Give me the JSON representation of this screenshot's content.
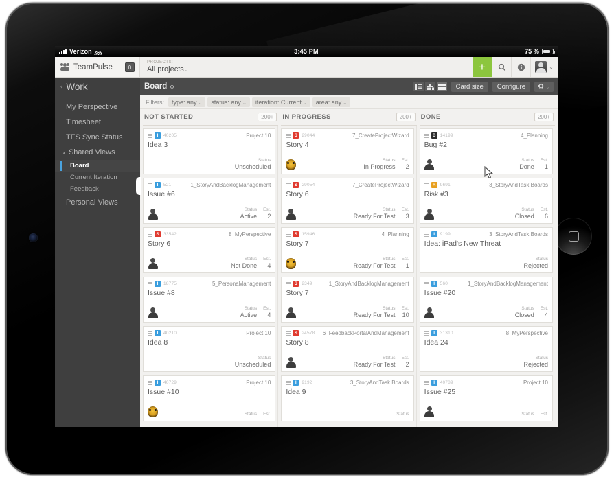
{
  "status_bar": {
    "carrier": "Verizon",
    "time": "3:45 PM",
    "battery": "75 %"
  },
  "app_bar": {
    "brand": "TeamPulse",
    "brand_badge": "0",
    "projects_label": "PROJECTS:",
    "projects_value": "All projects",
    "caret": "⌄",
    "add_icon": "+",
    "search_icon": "search-icon",
    "info_icon": "info-icon",
    "user_caret": "⌄"
  },
  "nav_bar": {
    "back_chevron": "‹",
    "section_title": "Work",
    "board_label": "Board",
    "card_size_label": "Card size",
    "configure_label": "Configure",
    "gear_icon": "⚙",
    "gear_caret": "⌄"
  },
  "sidebar": {
    "items": [
      {
        "label": "My Perspective",
        "type": "item"
      },
      {
        "label": "Timesheet",
        "type": "item"
      },
      {
        "label": "TFS Sync Status",
        "type": "item"
      },
      {
        "label": "Shared Views",
        "type": "group"
      },
      {
        "label": "Board",
        "type": "sub",
        "active": true
      },
      {
        "label": "Current Iteration",
        "type": "sub"
      },
      {
        "label": "Feedback",
        "type": "sub"
      },
      {
        "label": "Personal Views",
        "type": "item"
      }
    ]
  },
  "filters": {
    "label": "Filters:",
    "chips": [
      {
        "text": "type: any"
      },
      {
        "text": "status: any"
      },
      {
        "text": "iteration: Current"
      },
      {
        "text": "area: any"
      }
    ]
  },
  "columns": [
    {
      "title": "NOT STARTED",
      "count": "200+",
      "cards": [
        {
          "type": "idea",
          "badge": "I",
          "id": "40205",
          "project": "Project 10",
          "title": "Idea 3",
          "avatar": "none",
          "status_key": "Status",
          "status": "Unscheduled",
          "est_key": "",
          "est": ""
        },
        {
          "type": "issue",
          "badge": "I",
          "id": "521",
          "project": "1_StoryAndBacklogManagement",
          "title": "Issue #6",
          "avatar": "person",
          "status_key": "Status",
          "status": "Active",
          "est_key": "Est.",
          "est": "2"
        },
        {
          "type": "story",
          "badge": "S",
          "id": "33542",
          "project": "8_MyPerspective",
          "title": "Story 6",
          "avatar": "person",
          "status_key": "Status",
          "status": "Not Done",
          "est_key": "Est.",
          "est": "4"
        },
        {
          "type": "issue",
          "badge": "I",
          "id": "18775",
          "project": "5_PersonaManagement",
          "title": "Issue #8",
          "avatar": "person",
          "status_key": "Status",
          "status": "Active",
          "est_key": "Est.",
          "est": "4"
        },
        {
          "type": "idea",
          "badge": "I",
          "id": "40210",
          "project": "Project 10",
          "title": "Idea 8",
          "avatar": "none",
          "status_key": "Status",
          "status": "Unscheduled",
          "est_key": "",
          "est": ""
        },
        {
          "type": "issue",
          "badge": "I",
          "id": "40729",
          "project": "Project 10",
          "title": "Issue #10",
          "avatar": "cat",
          "status_key": "Status",
          "status": "",
          "est_key": "Est.",
          "est": ""
        }
      ]
    },
    {
      "title": "IN PROGRESS",
      "count": "200+",
      "cards": [
        {
          "type": "story",
          "badge": "S",
          "id": "29044",
          "project": "7_CreateProjectWizard",
          "title": "Story 4",
          "avatar": "cat",
          "status_key": "Status",
          "status": "In Progress",
          "est_key": "Est.",
          "est": "2"
        },
        {
          "type": "story",
          "badge": "S",
          "id": "29054",
          "project": "7_CreateProjectWizard",
          "title": "Story 6",
          "avatar": "person",
          "status_key": "Status",
          "status": "Ready For Test",
          "est_key": "Est.",
          "est": "3"
        },
        {
          "type": "story",
          "badge": "S",
          "id": "15946",
          "project": "4_Planning",
          "title": "Story 7",
          "avatar": "cat",
          "status_key": "Status",
          "status": "Ready For Test",
          "est_key": "Est.",
          "est": "1"
        },
        {
          "type": "story",
          "badge": "S",
          "id": "2349",
          "project": "1_StoryAndBacklogManagement",
          "title": "Story 7",
          "avatar": "person",
          "status_key": "Status",
          "status": "Ready For Test",
          "est_key": "Est.",
          "est": "10"
        },
        {
          "type": "story",
          "badge": "S",
          "id": "24578",
          "project": "6_FeedbackPortalAndManagement",
          "title": "Story 8",
          "avatar": "person",
          "status_key": "Status",
          "status": "Ready For Test",
          "est_key": "Est.",
          "est": "2"
        },
        {
          "type": "idea",
          "badge": "I",
          "id": "9192",
          "project": "3_StoryAndTask Boards",
          "title": "Idea 9",
          "avatar": "none",
          "status_key": "Status",
          "status": "",
          "est_key": "",
          "est": ""
        }
      ]
    },
    {
      "title": "DONE",
      "count": "200+",
      "cards": [
        {
          "type": "bug",
          "badge": "B",
          "id": "14199",
          "project": "4_Planning",
          "title": "Bug #2",
          "avatar": "person",
          "status_key": "Status",
          "status": "Done",
          "est_key": "Est.",
          "est": "1"
        },
        {
          "type": "risk",
          "badge": "R",
          "id": "9691",
          "project": "3_StoryAndTask Boards",
          "title": "Risk #3",
          "avatar": "person",
          "status_key": "Status",
          "status": "Closed",
          "est_key": "Est.",
          "est": "6"
        },
        {
          "type": "idea",
          "badge": "I",
          "id": "9199",
          "project": "3_StoryAndTask Boards",
          "title": "Idea: iPad's New Threat",
          "avatar": "none",
          "status_key": "Status",
          "status": "Rejected",
          "est_key": "",
          "est": ""
        },
        {
          "type": "issue",
          "badge": "I",
          "id": "560",
          "project": "1_StoryAndBacklogManagement",
          "title": "Issue #20",
          "avatar": "person",
          "status_key": "Status",
          "status": "Closed",
          "est_key": "Est.",
          "est": "4"
        },
        {
          "type": "idea",
          "badge": "I",
          "id": "31310",
          "project": "8_MyPerspective",
          "title": "Idea 24",
          "avatar": "none",
          "status_key": "Status",
          "status": "Rejected",
          "est_key": "",
          "est": ""
        },
        {
          "type": "issue",
          "badge": "I",
          "id": "40789",
          "project": "Project 10",
          "title": "Issue #25",
          "avatar": "person",
          "status_key": "Status",
          "status": "",
          "est_key": "Est.",
          "est": ""
        }
      ]
    }
  ],
  "colors": {
    "accent_green": "#8cc63e",
    "accent_blue": "#4aa3df",
    "type_idea": "#3b9ede",
    "type_story": "#e03a2f",
    "type_bug": "#2b2b2b",
    "type_risk": "#e8a020"
  }
}
